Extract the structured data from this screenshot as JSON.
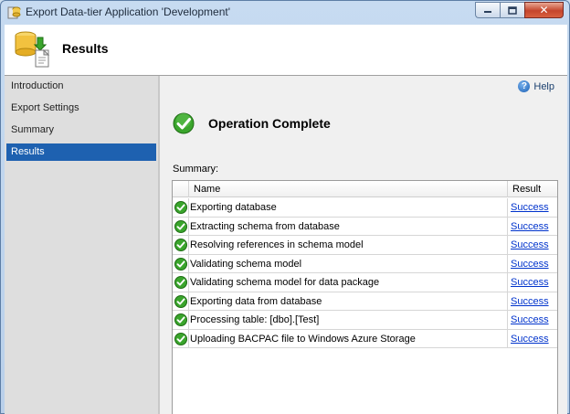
{
  "window": {
    "title": "Export Data-tier Application 'Development'"
  },
  "header": {
    "title": "Results"
  },
  "nav": {
    "items": [
      {
        "label": "Introduction"
      },
      {
        "label": "Export Settings"
      },
      {
        "label": "Summary"
      },
      {
        "label": "Results"
      }
    ],
    "selected": "Results"
  },
  "help": {
    "label": "Help"
  },
  "status": {
    "text": "Operation Complete"
  },
  "summary": {
    "label": "Summary:",
    "columns": {
      "name": "Name",
      "result": "Result"
    },
    "rows": [
      {
        "name": "Exporting database",
        "result": "Success"
      },
      {
        "name": "Extracting schema from database",
        "result": "Success"
      },
      {
        "name": "Resolving references in schema model",
        "result": "Success"
      },
      {
        "name": "Validating schema model",
        "result": "Success"
      },
      {
        "name": "Validating schema model for data package",
        "result": "Success"
      },
      {
        "name": "Exporting data from database",
        "result": "Success"
      },
      {
        "name": "Processing table: [dbo].[Test]",
        "result": "Success"
      },
      {
        "name": "Uploading BACPAC file to Windows Azure Storage",
        "result": "Success"
      }
    ]
  },
  "colors": {
    "selection": "#1e61b0",
    "link": "#0033cc",
    "success_green": "#3aa52c"
  }
}
